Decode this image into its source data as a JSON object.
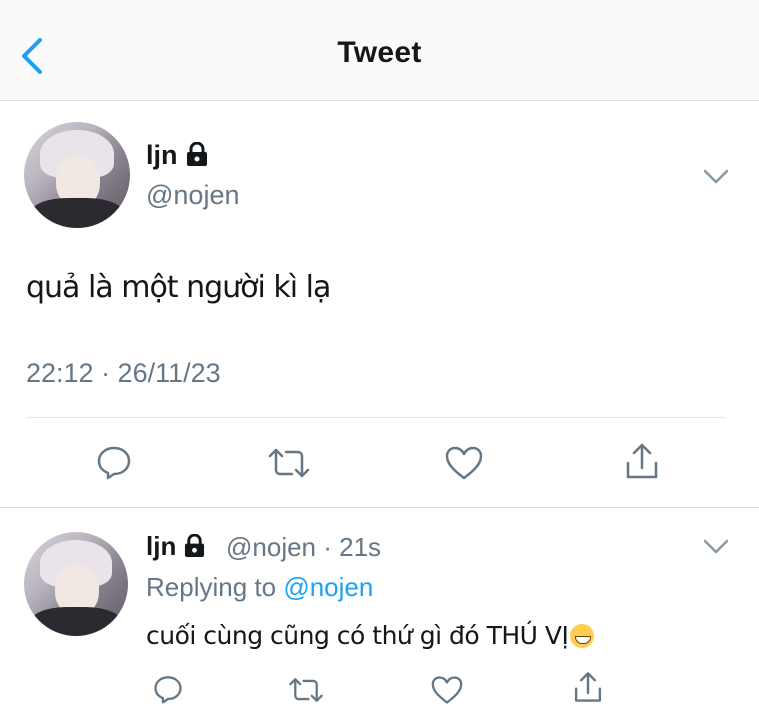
{
  "header": {
    "title": "Tweet"
  },
  "tweet": {
    "name": "ljn",
    "handle": "@nojen",
    "text": "quả là một người kì lạ",
    "timestamp": "22:12 · 26/11/23"
  },
  "reply": {
    "name": "ljn",
    "handle": "@nojen",
    "time": "21s",
    "replying_label": "Replying to",
    "replying_to": "@nojen",
    "text": "cuối cùng cũng có thứ gì đó THÚ VỊ"
  },
  "colors": {
    "accent": "#1da1f2",
    "muted": "#657786",
    "divider": "#e1e8ed"
  },
  "icons": [
    "chevron-left-icon",
    "lock-icon",
    "chevron-down-icon",
    "reply-icon",
    "retweet-icon",
    "like-icon",
    "share-icon",
    "grinning-emoji"
  ]
}
